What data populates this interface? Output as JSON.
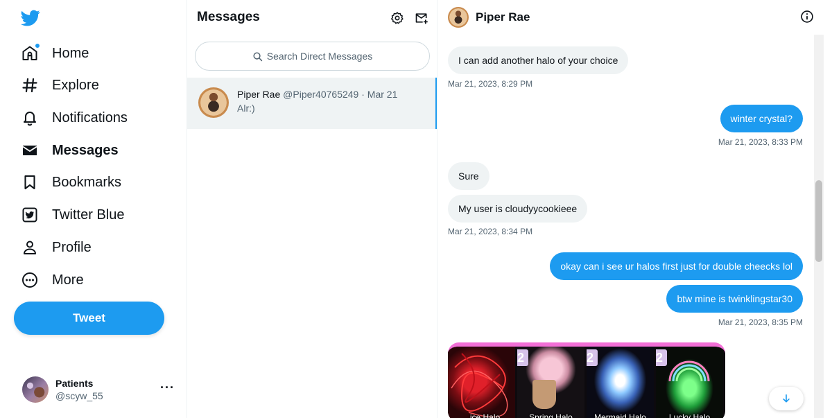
{
  "nav": {
    "items": [
      {
        "label": "Home",
        "icon": "home-icon"
      },
      {
        "label": "Explore",
        "icon": "hashtag-icon"
      },
      {
        "label": "Notifications",
        "icon": "bell-icon"
      },
      {
        "label": "Messages",
        "icon": "envelope-icon"
      },
      {
        "label": "Bookmarks",
        "icon": "bookmark-icon"
      },
      {
        "label": "Twitter Blue",
        "icon": "twitter-blue-icon"
      },
      {
        "label": "Profile",
        "icon": "person-icon"
      },
      {
        "label": "More",
        "icon": "more-circle-icon"
      }
    ],
    "active": "Messages",
    "tweet_label": "Tweet",
    "account": {
      "name": "Patients",
      "handle": "@scyw_55",
      "more": "···"
    }
  },
  "colors": {
    "accent": "#1d9bf0",
    "bubble_in": "#eff3f4",
    "text_secondary": "#536471"
  },
  "messages_pane": {
    "title": "Messages",
    "search_placeholder": "Search Direct Messages",
    "conversation": {
      "name": "Piper Rae",
      "meta": "@Piper40765249 · Mar 21",
      "preview": "Alr:)"
    }
  },
  "chat": {
    "name": "Piper Rae",
    "messages": [
      {
        "dir": "in",
        "text": "I can add another halo of your choice"
      },
      {
        "ts": "Mar 21, 2023, 8:29 PM"
      },
      {
        "dir": "out",
        "text": "winter crystal?"
      },
      {
        "ts": "Mar 21, 2023, 8:33 PM"
      },
      {
        "dir": "in",
        "text": "Sure"
      },
      {
        "dir": "in",
        "text": "My user is cloudyycookieee"
      },
      {
        "ts": "Mar 21, 2023, 8:34 PM"
      },
      {
        "dir": "out",
        "text": "okay can i see ur halos first just for double cheecks lol"
      },
      {
        "dir": "out",
        "text": "btw mine is twinklingstar30"
      },
      {
        "ts": "Mar 21, 2023, 8:35 PM"
      }
    ],
    "media_tiles": [
      {
        "badge": "",
        "label": "...ice Halo"
      },
      {
        "badge": "2",
        "label": "Spring Halo"
      },
      {
        "badge": "2",
        "label": "Mermaid Halo"
      },
      {
        "badge": "2",
        "label": "Lucky Halo"
      }
    ]
  }
}
